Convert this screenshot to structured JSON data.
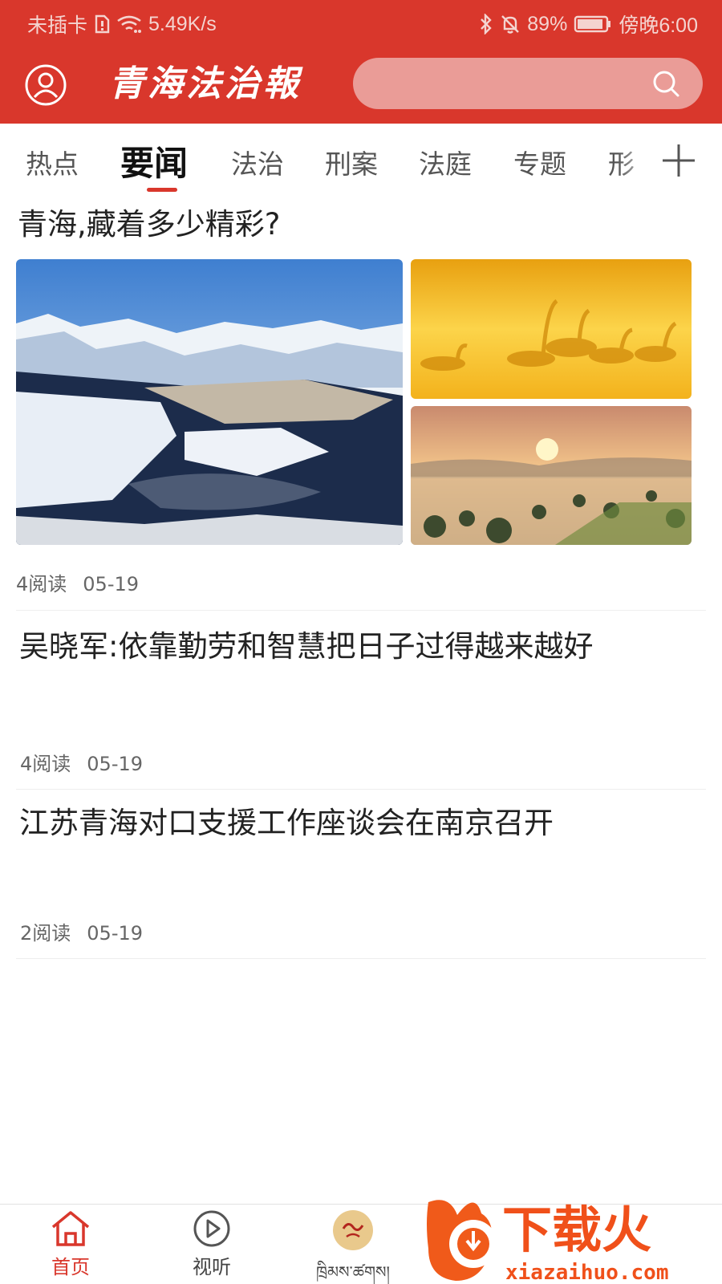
{
  "status_bar": {
    "carrier": "未插卡",
    "speed": "5.49K/s",
    "battery": "89%",
    "time": "傍晚6:00"
  },
  "header": {
    "logo_text": "青海法治報",
    "search_placeholder": "",
    "brand_color": "#d9372c",
    "search_bg_color": "#ea9c97"
  },
  "tabs": [
    {
      "label": "热点",
      "active": false
    },
    {
      "label": "要闻",
      "active": true
    },
    {
      "label": "法治",
      "active": false
    },
    {
      "label": "刑案",
      "active": false
    },
    {
      "label": "法庭",
      "active": false
    },
    {
      "label": "专题",
      "active": false
    },
    {
      "label": "形",
      "active": false
    }
  ],
  "articles": [
    {
      "title": "青海,藏着多少精彩?",
      "reads": "4阅读",
      "date": "05-19",
      "images": [
        "snow-mountain-lake-photo",
        "swans-at-sunset-photo",
        "foggy-sunrise-valley-photo"
      ]
    },
    {
      "title": "吴晓军:依靠勤劳和智慧把日子过得越来越好",
      "reads": "4阅读",
      "date": "05-19"
    },
    {
      "title": "江苏青海对口支援工作座谈会在南京召开",
      "reads": "2阅读",
      "date": "05-19"
    }
  ],
  "bottom_nav": {
    "items": [
      {
        "label": "首页",
        "icon": "home-icon",
        "active": true
      },
      {
        "label": "视听",
        "icon": "play-circle-icon",
        "active": false
      },
      {
        "label": "ཁྲིམས་ཚགས།",
        "icon": "tibetan-logo-icon",
        "active": false
      }
    ]
  },
  "watermark": {
    "brand": "下载火",
    "site": "xiazaihuo.com"
  }
}
